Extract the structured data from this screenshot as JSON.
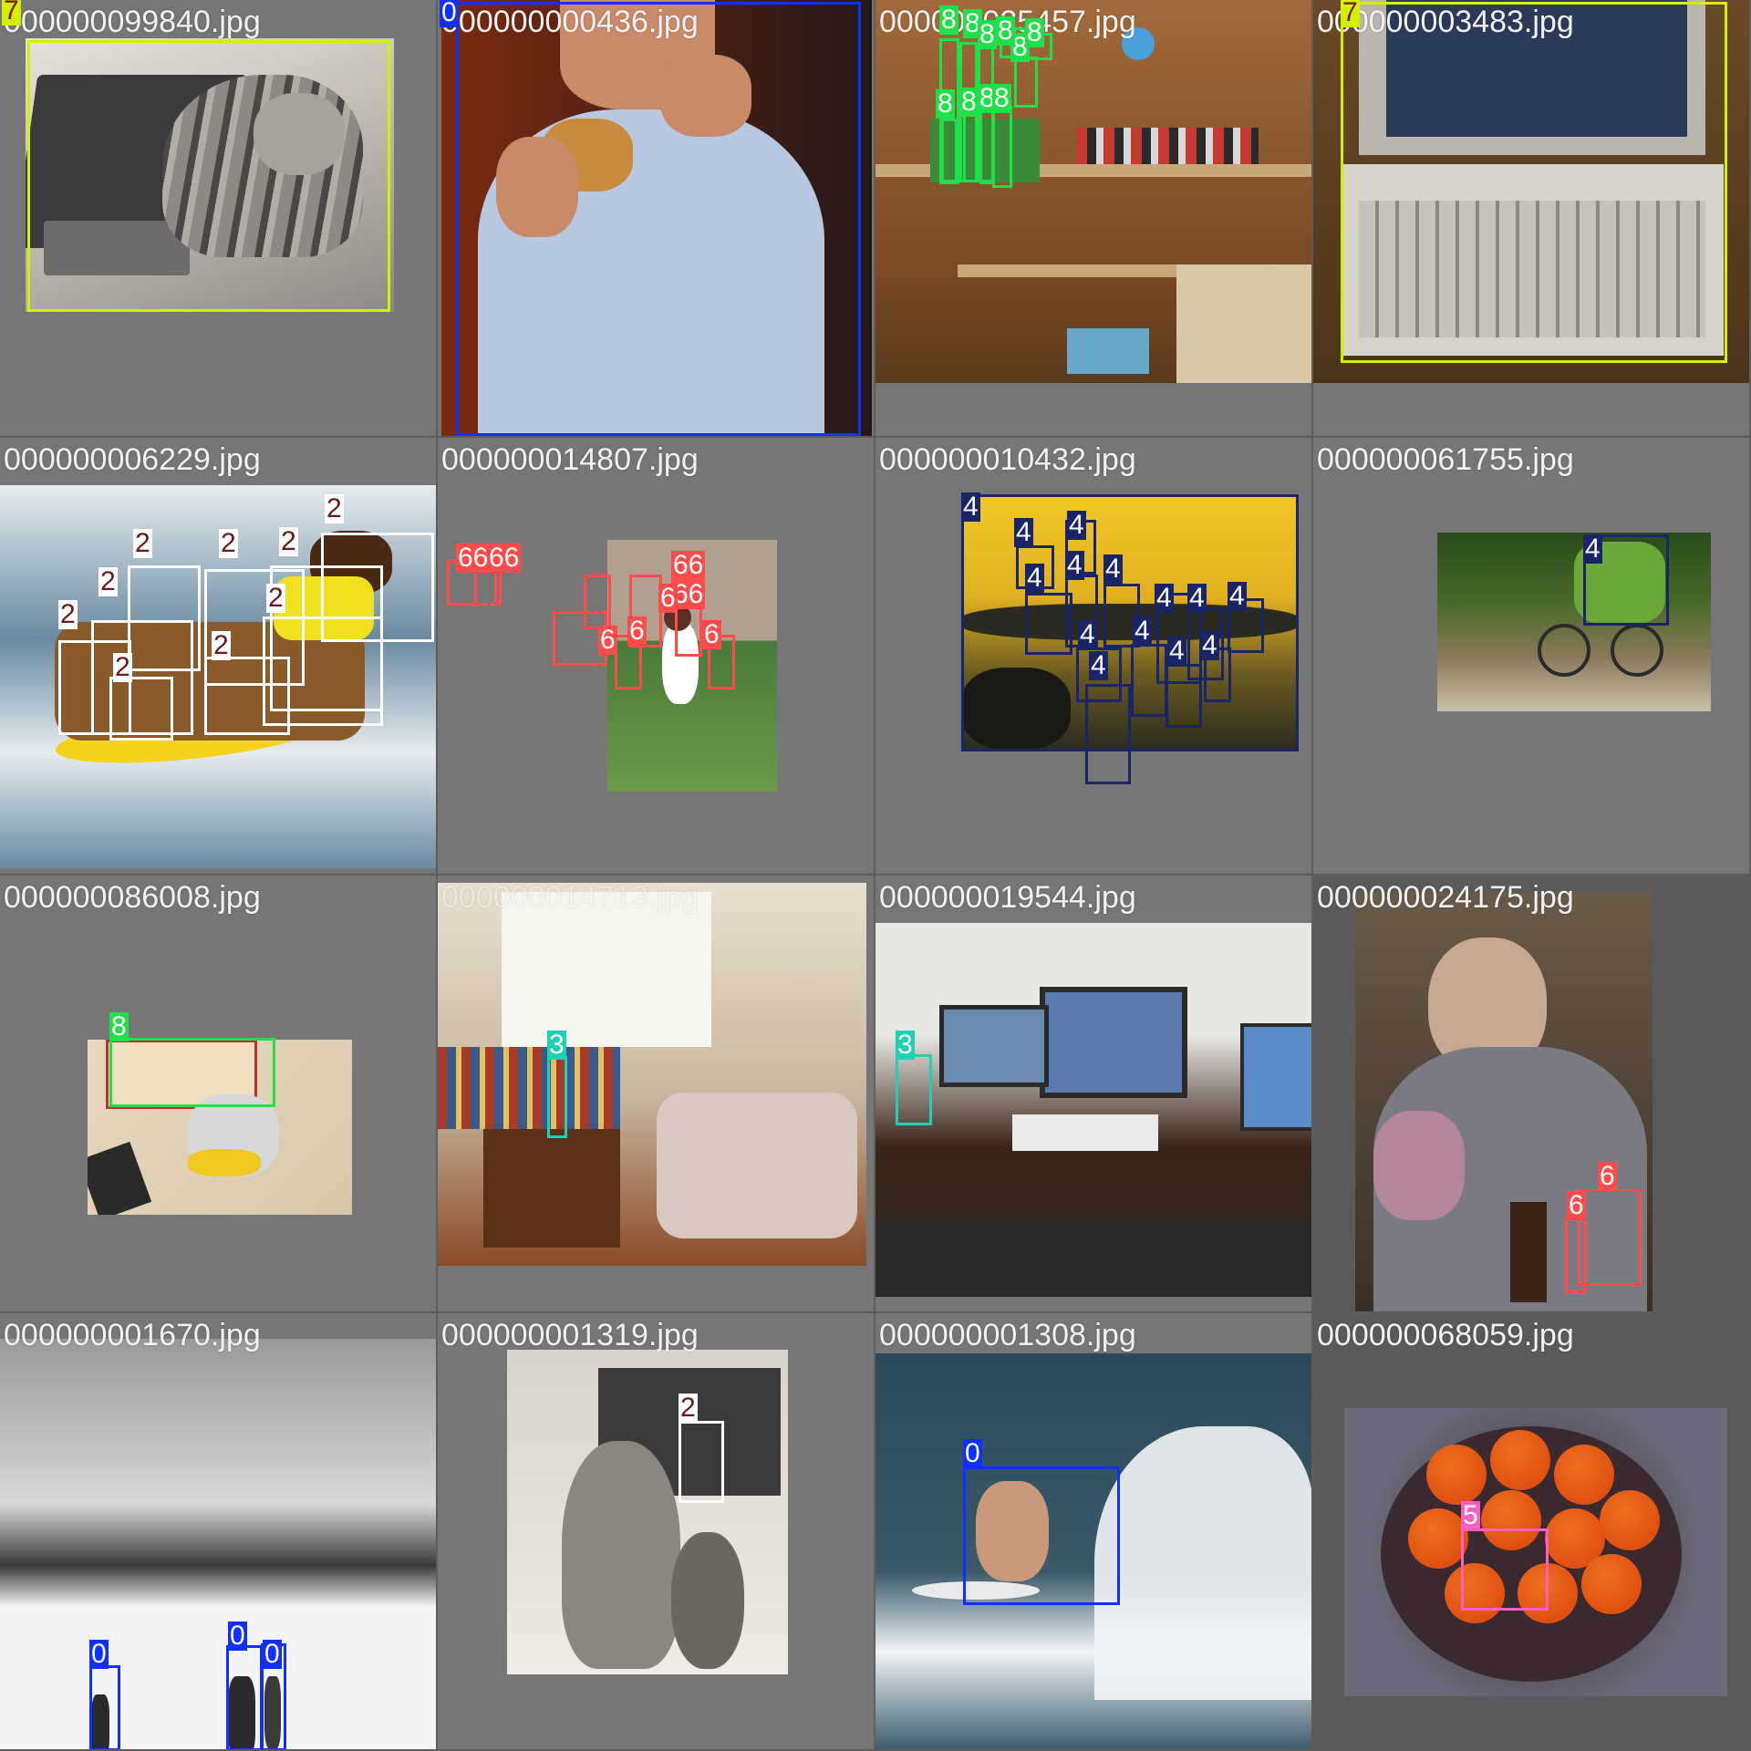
{
  "classes": {
    "0": "#1030ff",
    "2": "#ffffff",
    "3": "#20d0b0",
    "4": "#1a2468",
    "5": "#ff60c0",
    "6": "#ff4b4b",
    "7": "#d4f000",
    "8": "#20e04a"
  },
  "tiles": [
    {
      "filename": "000000099840.jpg",
      "bg": "#767676",
      "scene": "cat-on-laptop",
      "photo_colors": [
        "#c9c4bb",
        "#3a3a3c",
        "#8d8a86",
        "#e5e2dc"
      ],
      "boxes": [
        {
          "label": "7"
        }
      ]
    },
    {
      "filename": "000000000436.jpg",
      "bg": "#767676",
      "scene": "man-eating-donut",
      "photo_colors": [
        "#7a2a10",
        "#b8c8e0",
        "#c98a6a",
        "#241818"
      ],
      "boxes": [
        {
          "label": "0"
        }
      ]
    },
    {
      "filename": "000000025457.jpg",
      "bg": "#767676",
      "scene": "workshop-shelves",
      "photo_colors": [
        "#7a4a24",
        "#a26a3c",
        "#d8c8a8",
        "#c43a30"
      ],
      "boxes": [
        {
          "label": "8"
        },
        {
          "label": "8"
        },
        {
          "label": "8"
        },
        {
          "label": "8"
        },
        {
          "label": "8"
        },
        {
          "label": "8"
        },
        {
          "label": "8"
        },
        {
          "label": "8"
        },
        {
          "label": "8"
        },
        {
          "label": "8"
        }
      ]
    },
    {
      "filename": "000000003483.jpg",
      "bg": "#767676",
      "scene": "toshiba-laptop",
      "photo_colors": [
        "#6a4a28",
        "#b8b6ad",
        "#d6d4cb",
        "#2c3a5a"
      ],
      "boxes": [
        {
          "label": "7"
        }
      ]
    },
    {
      "filename": "000000006229.jpg",
      "bg": "#767676",
      "scene": "dogs-surfing",
      "photo_colors": [
        "#6a8aa0",
        "#e6ecef",
        "#f2d21a",
        "#8a5a2a"
      ],
      "boxes": [
        {
          "label": "2"
        },
        {
          "label": "2"
        },
        {
          "label": "2"
        },
        {
          "label": "2"
        },
        {
          "label": "2"
        },
        {
          "label": "2"
        },
        {
          "label": "2"
        },
        {
          "label": "2"
        },
        {
          "label": "2"
        }
      ]
    },
    {
      "filename": "000000014807.jpg",
      "bg": "#767676",
      "scene": "tennis-player",
      "photo_colors": [
        "#4a7a3a",
        "#6a9a4a",
        "#b0a090",
        "#ffffff"
      ],
      "boxes": [
        {
          "label": "66"
        },
        {
          "label": "66"
        },
        {
          "label": "66"
        },
        {
          "label": "6"
        },
        {
          "label": "6"
        },
        {
          "label": "6"
        },
        {
          "label": "66"
        },
        {
          "label": "6"
        }
      ]
    },
    {
      "filename": "000000010432.jpg",
      "bg": "#767676",
      "scene": "banana-stall",
      "photo_colors": [
        "#e0b020",
        "#f2c828",
        "#2a2a20",
        "#6a5a20"
      ],
      "boxes": [
        {
          "label": "4"
        },
        {
          "label": "4"
        },
        {
          "label": "4"
        },
        {
          "label": "4"
        },
        {
          "label": "4"
        },
        {
          "label": "4"
        },
        {
          "label": "4"
        },
        {
          "label": "4"
        },
        {
          "label": "4"
        },
        {
          "label": "4"
        },
        {
          "label": "4"
        },
        {
          "label": "4"
        },
        {
          "label": "4"
        },
        {
          "label": "4"
        }
      ]
    },
    {
      "filename": "000000061755.jpg",
      "bg": "#767676",
      "scene": "bananas-on-bicycle",
      "photo_colors": [
        "#4a6a2a",
        "#8a7a5a",
        "#c8c0a8",
        "#2a4a1a"
      ],
      "boxes": [
        {
          "label": "4"
        }
      ]
    },
    {
      "filename": "000000086008.jpg",
      "bg": "#767676",
      "scene": "pen-cup-desk",
      "photo_colors": [
        "#e8d8c0",
        "#c03030",
        "#f0c820",
        "#2a2a2a"
      ],
      "boxes": [
        {
          "label": "8"
        }
      ]
    },
    {
      "filename": "000000014713.jpg",
      "bg": "#767676",
      "scene": "living-room",
      "photo_colors": [
        "#8a4a28",
        "#e8e0d0",
        "#c8b8a0",
        "#f6f6ee"
      ],
      "boxes": [
        {
          "label": "3"
        }
      ]
    },
    {
      "filename": "000000019544.jpg",
      "bg": "#767676",
      "scene": "computer-desk",
      "photo_colors": [
        "#3a2418",
        "#e8e8e4",
        "#2a2a2a",
        "#5a7ab0"
      ],
      "boxes": [
        {
          "label": "3"
        }
      ]
    },
    {
      "filename": "000000024175.jpg",
      "bg": "#5a5a5a",
      "scene": "man-at-table",
      "photo_colors": [
        "#3a3028",
        "#6a5a48",
        "#c8a890",
        "#d890a8"
      ],
      "boxes": [
        {
          "label": "6"
        },
        {
          "label": "6"
        }
      ]
    },
    {
      "filename": "000000001670.jpg",
      "bg": "#767676",
      "scene": "snowy-mountain",
      "photo_colors": [
        "#d8d8d8",
        "#9a9a9a",
        "#f4f4f6",
        "#3a3a3a"
      ],
      "boxes": [
        {
          "label": "0"
        },
        {
          "label": "0"
        },
        {
          "label": "0"
        }
      ]
    },
    {
      "filename": "000000001319.jpg",
      "bg": "#767676",
      "scene": "cats-watching-tv",
      "photo_colors": [
        "#d8d4cc",
        "#8a8680",
        "#3a3a3a",
        "#f0ece4"
      ],
      "boxes": [
        {
          "label": "2"
        }
      ]
    },
    {
      "filename": "000000001308.jpg",
      "bg": "#767676",
      "scene": "surfer-wave",
      "photo_colors": [
        "#2a4a5a",
        "#3a5a6a",
        "#f2f4f6",
        "#c89a7a"
      ],
      "boxes": [
        {
          "label": "0"
        }
      ]
    },
    {
      "filename": "000000068059.jpg",
      "bg": "#5a5a5a",
      "scene": "bowl-of-oranges",
      "photo_colors": [
        "#e05010",
        "#6a6a7a",
        "#3a2a30",
        "#f07020"
      ],
      "boxes": [
        {
          "label": "5"
        }
      ]
    }
  ]
}
